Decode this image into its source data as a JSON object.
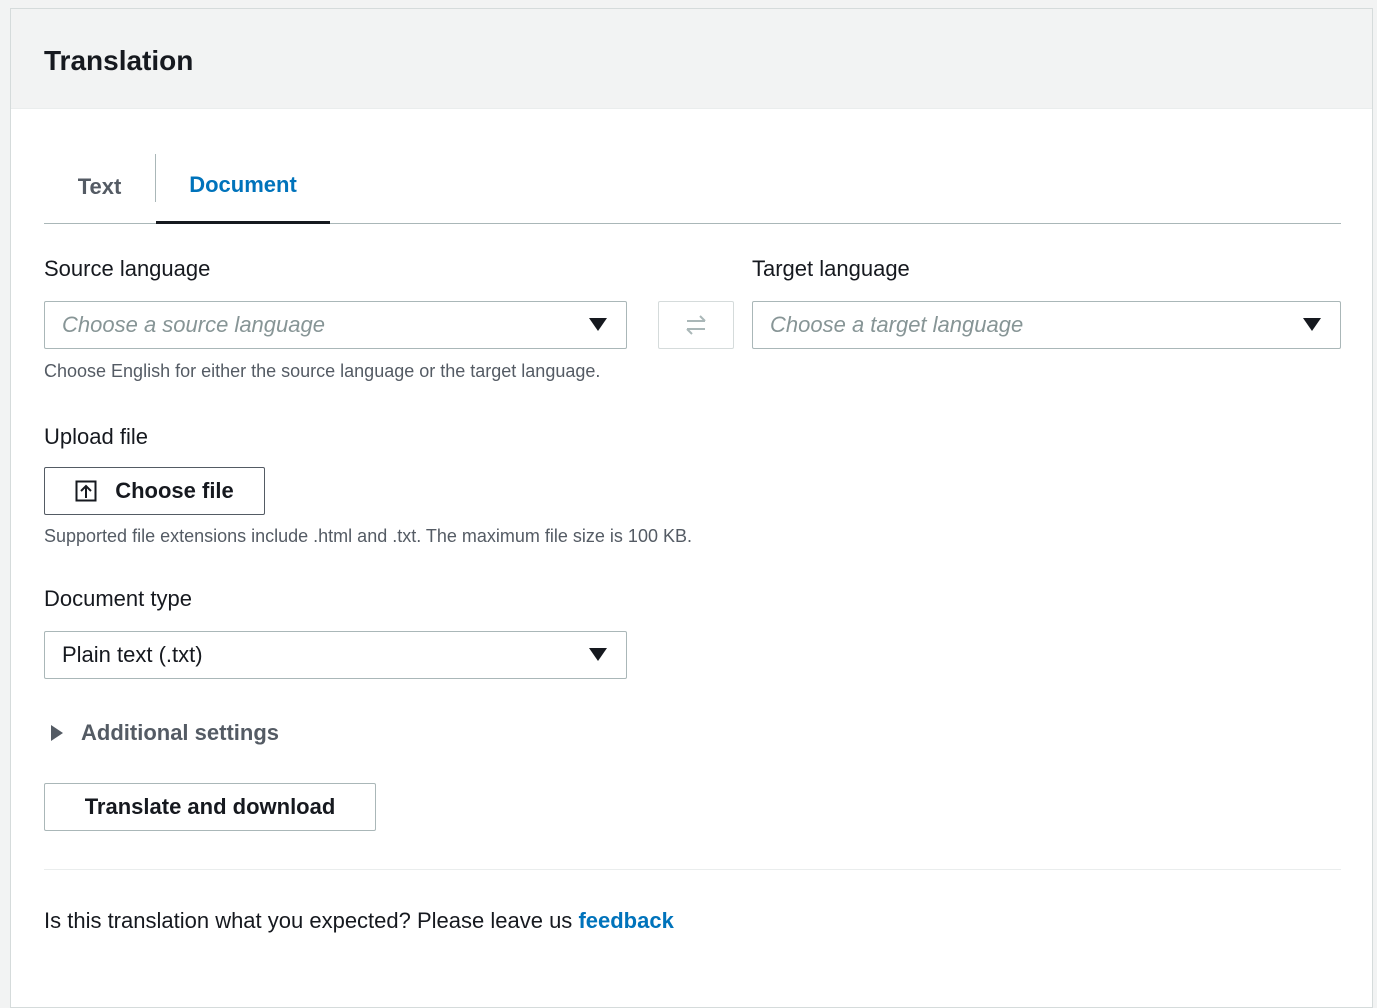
{
  "panel": {
    "title": "Translation"
  },
  "tabs": [
    {
      "label": "Text",
      "active": false
    },
    {
      "label": "Document",
      "active": true
    }
  ],
  "source": {
    "label": "Source language",
    "placeholder": "Choose a source language",
    "hint": "Choose English for either the source language or the target language."
  },
  "target": {
    "label": "Target language",
    "placeholder": "Choose a target language"
  },
  "swap_icon": "swap-arrows-icon",
  "upload": {
    "label": "Upload file",
    "button_label": "Choose file",
    "icon": "upload-icon",
    "hint": "Supported file extensions include .html and .txt. The maximum file size is 100 KB."
  },
  "doc_type": {
    "label": "Document type",
    "value": "Plain text (.txt)"
  },
  "additional_settings": {
    "label": "Additional settings",
    "expanded": false
  },
  "translate_button": {
    "label": "Translate and download"
  },
  "feedback": {
    "text": "Is this translation what you expected? Please leave us ",
    "link": "feedback"
  },
  "colors": {
    "accent": "#0073bb",
    "text": "#16191f",
    "muted": "#545b64",
    "border": "#aab7b8"
  }
}
